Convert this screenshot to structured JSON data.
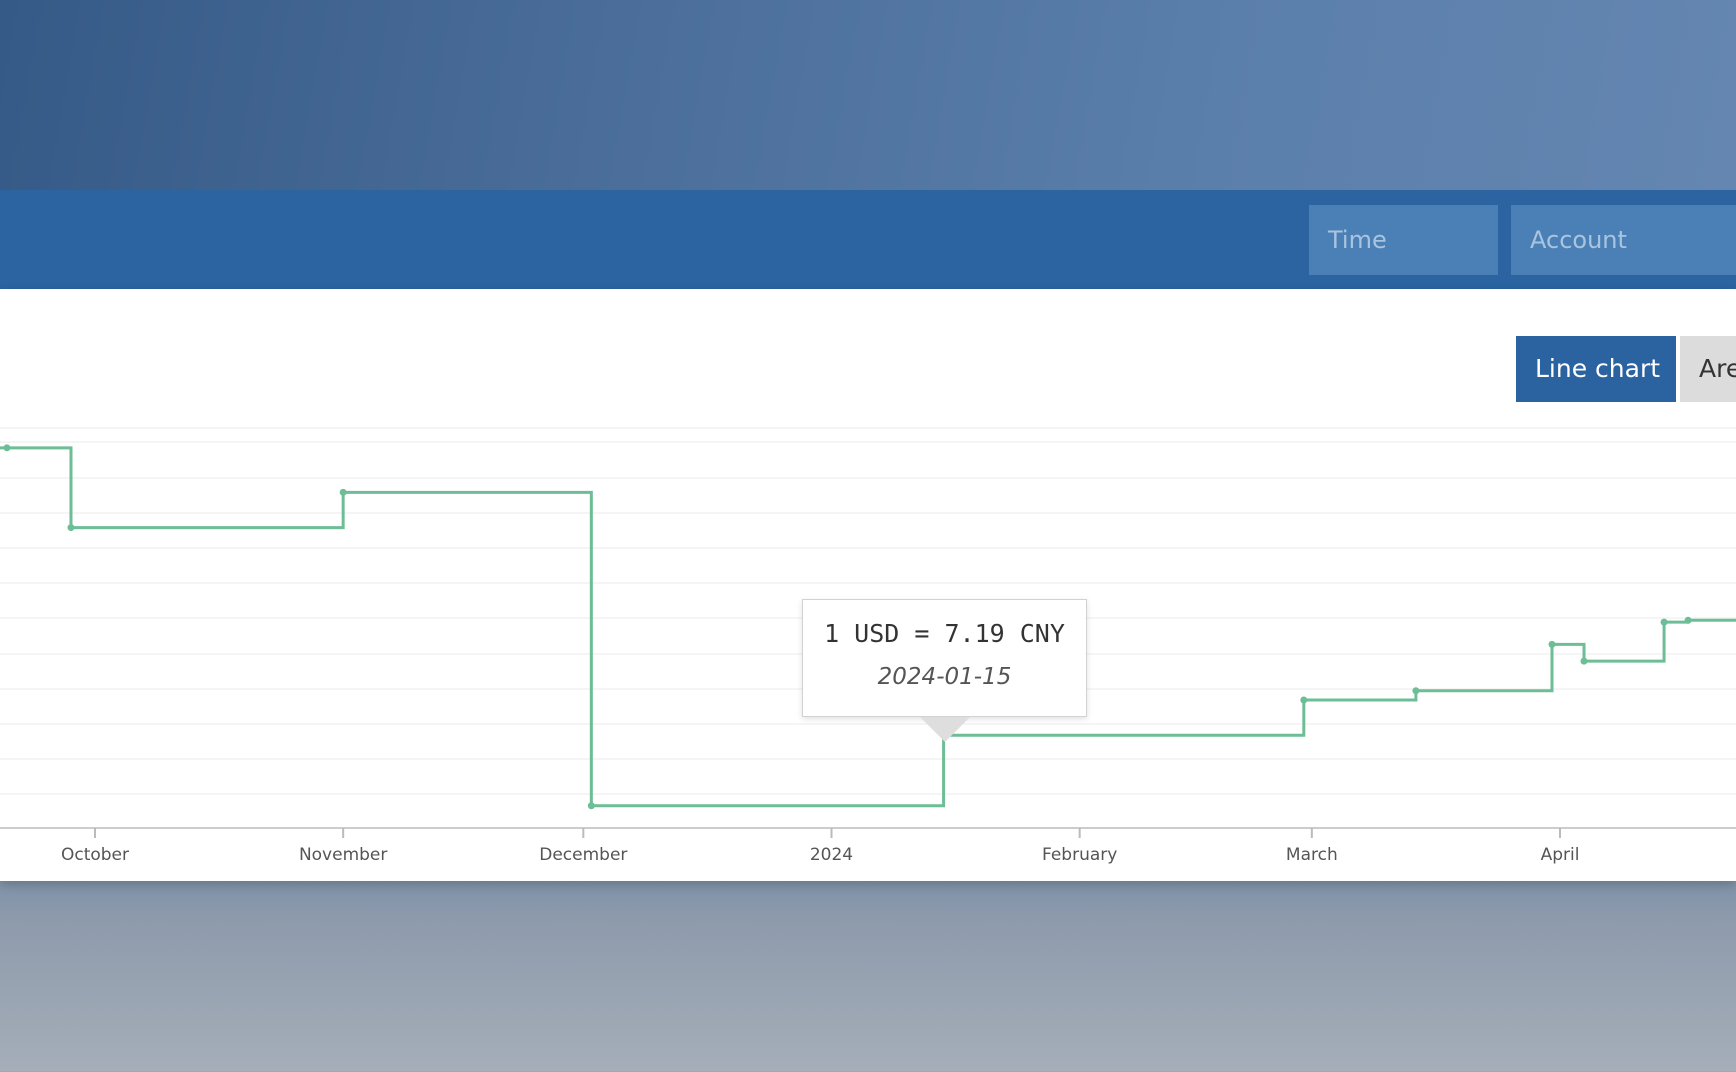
{
  "filters": {
    "time_placeholder": "Time",
    "account_placeholder": "Account"
  },
  "chart_toggle": {
    "line_label": "Line chart",
    "area_label": "Are",
    "selected": "Line chart"
  },
  "tooltip": {
    "value_text": "1 USD = 7.19 CNY",
    "date_text": "2024-01-15"
  },
  "colors": {
    "series_line": "#6dbd96",
    "header_bar": "#2b64a1",
    "selected_button": "#2b62a0"
  },
  "chart_data": {
    "type": "line",
    "step": true,
    "x_axis": {
      "type": "time",
      "ticks": [
        {
          "date": "2023-10-01",
          "label": "October"
        },
        {
          "date": "2023-11-01",
          "label": "November"
        },
        {
          "date": "2023-12-01",
          "label": "December"
        },
        {
          "date": "2024-01-01",
          "label": "2024"
        },
        {
          "date": "2024-02-01",
          "label": "February"
        },
        {
          "date": "2024-03-01",
          "label": "March"
        },
        {
          "date": "2024-04-01",
          "label": "April"
        }
      ]
    },
    "y_axis": {
      "labels_visible": false,
      "grid": true,
      "ylim": [
        7.1,
        7.32
      ]
    },
    "series": [
      {
        "points": [
          {
            "date": "2023-09-20",
            "value": 7.305
          },
          {
            "date": "2023-09-28",
            "value": 7.262
          },
          {
            "date": "2023-11-01",
            "value": 7.281
          },
          {
            "date": "2023-12-02",
            "value": 7.112
          },
          {
            "date": "2024-01-15",
            "value": 7.15
          },
          {
            "date": "2024-02-29",
            "value": 7.169
          },
          {
            "date": "2024-03-14",
            "value": 7.174
          },
          {
            "date": "2024-03-31",
            "value": 7.199
          },
          {
            "date": "2024-04-04",
            "value": 7.19
          },
          {
            "date": "2024-04-14",
            "value": 7.211
          },
          {
            "date": "2024-04-17",
            "value": 7.212
          },
          {
            "date": "2024-04-30",
            "value": 7.212
          }
        ]
      }
    ]
  }
}
